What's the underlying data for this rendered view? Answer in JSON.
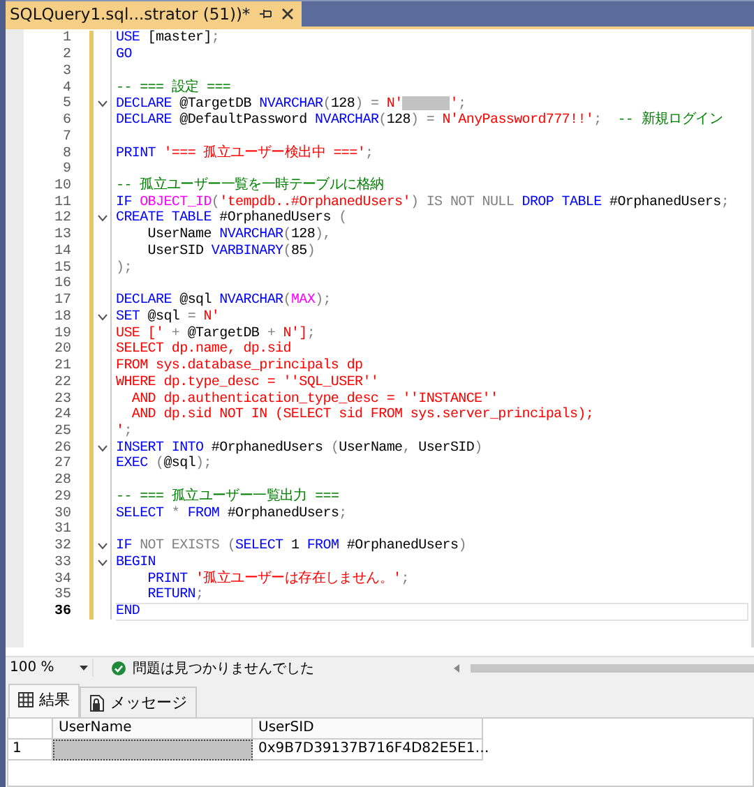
{
  "tab": {
    "title": "SQLQuery1.sql...strator (51))*"
  },
  "editor": {
    "lines": [
      {
        "number": "1",
        "current": false,
        "fold": false,
        "tokens": [
          {
            "kind": "kw",
            "text": "USE"
          },
          {
            "kind": "id",
            "text": " [master]"
          },
          {
            "kind": "op",
            "text": ";"
          }
        ]
      },
      {
        "number": "2",
        "current": false,
        "fold": false,
        "tokens": [
          {
            "kind": "kw",
            "text": "GO"
          }
        ]
      },
      {
        "number": "3",
        "current": false,
        "fold": false
      },
      {
        "number": "4",
        "current": false,
        "fold": false,
        "tokens": [
          {
            "kind": "cmt",
            "text": "-- === 設定 ==="
          }
        ]
      },
      {
        "number": "5",
        "current": false,
        "fold": true,
        "tokens": [
          {
            "kind": "kw",
            "text": "DECLARE"
          },
          {
            "kind": "id",
            "text": " @TargetDB "
          },
          {
            "kind": "kw",
            "text": "NVARCHAR"
          },
          {
            "kind": "op",
            "text": "("
          },
          {
            "kind": "id",
            "text": "128"
          },
          {
            "kind": "op",
            "text": ") = "
          },
          {
            "kind": "str",
            "text": "N'"
          },
          {
            "kind": "redacted"
          },
          {
            "kind": "str",
            "text": "'"
          },
          {
            "kind": "op",
            "text": ";"
          }
        ]
      },
      {
        "number": "6",
        "current": false,
        "fold": false,
        "tokens": [
          {
            "kind": "kw",
            "text": "DECLARE"
          },
          {
            "kind": "id",
            "text": " @DefaultPassword "
          },
          {
            "kind": "kw",
            "text": "NVARCHAR"
          },
          {
            "kind": "op",
            "text": "("
          },
          {
            "kind": "id",
            "text": "128"
          },
          {
            "kind": "op",
            "text": ") = "
          },
          {
            "kind": "str",
            "text": "N'AnyPassword777!!'"
          },
          {
            "kind": "op",
            "text": ";"
          },
          {
            "kind": "cmt",
            "text": "  -- 新規ログイン"
          }
        ]
      },
      {
        "number": "7",
        "current": false,
        "fold": false
      },
      {
        "number": "8",
        "current": false,
        "fold": false,
        "tokens": [
          {
            "kind": "kw",
            "text": "PRINT"
          },
          {
            "kind": "str",
            "text": " '=== 孤立ユーザー検出中 ==='"
          },
          {
            "kind": "op",
            "text": ";"
          }
        ]
      },
      {
        "number": "9",
        "current": false,
        "fold": false
      },
      {
        "number": "10",
        "current": false,
        "fold": false,
        "tokens": [
          {
            "kind": "cmt",
            "text": "-- 孤立ユーザー一覧を一時テーブルに格納"
          }
        ]
      },
      {
        "number": "11",
        "current": false,
        "fold": false,
        "tokens": [
          {
            "kind": "kw",
            "text": "IF"
          },
          {
            "kind": "fn",
            "text": " OBJECT_ID"
          },
          {
            "kind": "op",
            "text": "("
          },
          {
            "kind": "str",
            "text": "'tempdb..#OrphanedUsers'"
          },
          {
            "kind": "op",
            "text": ") IS NOT NULL "
          },
          {
            "kind": "kw",
            "text": "DROP TABLE"
          },
          {
            "kind": "id",
            "text": " #OrphanedUsers"
          },
          {
            "kind": "op",
            "text": ";"
          }
        ]
      },
      {
        "number": "12",
        "current": false,
        "fold": true,
        "tokens": [
          {
            "kind": "kw",
            "text": "CREATE TABLE"
          },
          {
            "kind": "id",
            "text": " #OrphanedUsers "
          },
          {
            "kind": "op",
            "text": "("
          }
        ]
      },
      {
        "number": "13",
        "current": false,
        "fold": false,
        "tokens": [
          {
            "kind": "id",
            "text": "    UserName "
          },
          {
            "kind": "kw",
            "text": "NVARCHAR"
          },
          {
            "kind": "op",
            "text": "("
          },
          {
            "kind": "id",
            "text": "128"
          },
          {
            "kind": "op",
            "text": "),"
          }
        ]
      },
      {
        "number": "14",
        "current": false,
        "fold": false,
        "tokens": [
          {
            "kind": "id",
            "text": "    UserSID "
          },
          {
            "kind": "kw",
            "text": "VARBINARY"
          },
          {
            "kind": "op",
            "text": "("
          },
          {
            "kind": "id",
            "text": "85"
          },
          {
            "kind": "op",
            "text": ")"
          }
        ]
      },
      {
        "number": "15",
        "current": false,
        "fold": false,
        "tokens": [
          {
            "kind": "op",
            "text": ");"
          }
        ]
      },
      {
        "number": "16",
        "current": false,
        "fold": false
      },
      {
        "number": "17",
        "current": false,
        "fold": false,
        "tokens": [
          {
            "kind": "kw",
            "text": "DECLARE"
          },
          {
            "kind": "id",
            "text": " @sql "
          },
          {
            "kind": "kw",
            "text": "NVARCHAR"
          },
          {
            "kind": "op",
            "text": "("
          },
          {
            "kind": "fn",
            "text": "MAX"
          },
          {
            "kind": "op",
            "text": ");"
          }
        ]
      },
      {
        "number": "18",
        "current": false,
        "fold": true,
        "tokens": [
          {
            "kind": "kw",
            "text": "SET"
          },
          {
            "kind": "id",
            "text": " @sql "
          },
          {
            "kind": "op",
            "text": "= "
          },
          {
            "kind": "str",
            "text": "N'"
          }
        ]
      },
      {
        "number": "19",
        "current": false,
        "fold": false,
        "tokens": [
          {
            "kind": "str",
            "text": "USE ['"
          },
          {
            "kind": "op",
            "text": " + "
          },
          {
            "kind": "id",
            "text": "@TargetDB"
          },
          {
            "kind": "op",
            "text": " + "
          },
          {
            "kind": "str",
            "text": "N']"
          },
          {
            "kind": "op",
            "text": ";"
          }
        ]
      },
      {
        "number": "20",
        "current": false,
        "fold": false,
        "tokens": [
          {
            "kind": "str",
            "text": "SELECT dp.name, dp.sid"
          }
        ]
      },
      {
        "number": "21",
        "current": false,
        "fold": false,
        "tokens": [
          {
            "kind": "str",
            "text": "FROM sys.database_principals dp"
          }
        ]
      },
      {
        "number": "22",
        "current": false,
        "fold": false,
        "tokens": [
          {
            "kind": "str",
            "text": "WHERE dp.type_desc = ''SQL_USER''"
          }
        ]
      },
      {
        "number": "23",
        "current": false,
        "fold": false,
        "tokens": [
          {
            "kind": "str",
            "text": "  AND dp.authentication_type_desc = ''INSTANCE''"
          }
        ]
      },
      {
        "number": "24",
        "current": false,
        "fold": false,
        "tokens": [
          {
            "kind": "str",
            "text": "  AND dp.sid NOT IN (SELECT sid FROM sys.server_principals);"
          }
        ]
      },
      {
        "number": "25",
        "current": false,
        "fold": false,
        "tokens": [
          {
            "kind": "str",
            "text": "'"
          },
          {
            "kind": "op",
            "text": ";"
          }
        ]
      },
      {
        "number": "26",
        "current": false,
        "fold": true,
        "tokens": [
          {
            "kind": "kw",
            "text": "INSERT INTO"
          },
          {
            "kind": "id",
            "text": " #OrphanedUsers "
          },
          {
            "kind": "op",
            "text": "("
          },
          {
            "kind": "id",
            "text": "UserName"
          },
          {
            "kind": "op",
            "text": ","
          },
          {
            "kind": "id",
            "text": " UserSID"
          },
          {
            "kind": "op",
            "text": ")"
          }
        ]
      },
      {
        "number": "27",
        "current": false,
        "fold": false,
        "tokens": [
          {
            "kind": "kw",
            "text": "EXEC"
          },
          {
            "kind": "op",
            "text": " ("
          },
          {
            "kind": "id",
            "text": "@sql"
          },
          {
            "kind": "op",
            "text": ");"
          }
        ]
      },
      {
        "number": "28",
        "current": false,
        "fold": false
      },
      {
        "number": "29",
        "current": false,
        "fold": false,
        "tokens": [
          {
            "kind": "cmt",
            "text": "-- === 孤立ユーザー一覧出力 ==="
          }
        ]
      },
      {
        "number": "30",
        "current": false,
        "fold": false,
        "tokens": [
          {
            "kind": "kw",
            "text": "SELECT"
          },
          {
            "kind": "op",
            "text": " * "
          },
          {
            "kind": "kw",
            "text": "FROM"
          },
          {
            "kind": "id",
            "text": " #OrphanedUsers"
          },
          {
            "kind": "op",
            "text": ";"
          }
        ]
      },
      {
        "number": "31",
        "current": false,
        "fold": false
      },
      {
        "number": "32",
        "current": false,
        "fold": true,
        "tokens": [
          {
            "kind": "kw",
            "text": "IF"
          },
          {
            "kind": "op",
            "text": " NOT EXISTS ("
          },
          {
            "kind": "kw",
            "text": "SELECT"
          },
          {
            "kind": "id",
            "text": " 1 "
          },
          {
            "kind": "kw",
            "text": "FROM"
          },
          {
            "kind": "id",
            "text": " #OrphanedUsers"
          },
          {
            "kind": "op",
            "text": ")"
          }
        ]
      },
      {
        "number": "33",
        "current": false,
        "fold": true,
        "tokens": [
          {
            "kind": "kw",
            "text": "BEGIN"
          }
        ]
      },
      {
        "number": "34",
        "current": false,
        "fold": false,
        "tokens": [
          {
            "kind": "kw",
            "text": "    PRINT"
          },
          {
            "kind": "str",
            "text": " '孤立ユーザーは存在しません。'"
          },
          {
            "kind": "op",
            "text": ";"
          }
        ]
      },
      {
        "number": "35",
        "current": false,
        "fold": false,
        "tokens": [
          {
            "kind": "kw",
            "text": "    RETURN"
          },
          {
            "kind": "op",
            "text": ";"
          }
        ]
      },
      {
        "number": "36",
        "current": true,
        "fold": false,
        "tokens": [
          {
            "kind": "kw",
            "text": "END"
          }
        ]
      }
    ]
  },
  "status_bar": {
    "zoom": "100 %",
    "message": "問題は見つかりませんでした"
  },
  "results": {
    "tabs": [
      {
        "label": "結果",
        "kind": "grid",
        "selected": true
      },
      {
        "label": "メッセージ",
        "kind": "message",
        "selected": false
      }
    ],
    "columns": [
      "UserName",
      "UserSID"
    ],
    "rows": [
      {
        "number": "1",
        "cells": [
          {
            "kind": "redacted",
            "selected": true
          },
          {
            "kind": "text",
            "text": "0x9B7D39137B716F4D82E5E1…",
            "selected": false
          }
        ]
      }
    ]
  }
}
